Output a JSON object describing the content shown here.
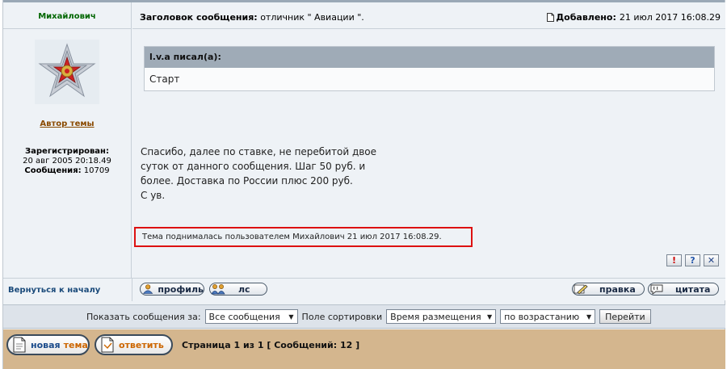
{
  "author": {
    "name": "Михайлович",
    "role": "Автор темы",
    "registered_label": "Зарегистрирован:",
    "registered_date": "20 авг 2005 20:18.49",
    "posts_label": "Сообщения:",
    "posts_count": "10709",
    "avatar_icon": "medal-icon"
  },
  "message": {
    "subject_label": "Заголовок сообщения:",
    "subject": "отличник \" Авиации \".",
    "added_label": "Добавлено:",
    "added_date": "21 июл 2017 16:08.29",
    "quote_author": "l.v.a писал(а):",
    "quote_text": "Старт",
    "body_lines": [
      "Спасибо, далее по ставке, не перебитой двое",
      "суток от данного сообщения. Шаг 50 руб. и",
      "более. Доставка по России плюс 200 руб.",
      "С ув."
    ],
    "bump_text": "Тема поднималась пользователем Михайлович 21 июл 2017 16:08.29.",
    "icons": [
      "report-icon",
      "help-icon",
      "close-icon"
    ]
  },
  "actions": {
    "back_to_top": "Вернуться к началу",
    "profile": "профиль",
    "pm": "лс",
    "edit": "правка",
    "quote": "цитата"
  },
  "sort": {
    "show_label": "Показать сообщения за:",
    "show_value": "Все сообщения",
    "sort_label": "Поле сортировки",
    "sort_value": "Время размещения",
    "order_value": "по возрастанию",
    "go": "Перейти"
  },
  "bottom": {
    "new_topic_a": "новая",
    "new_topic_b": "тема",
    "reply": "ответить",
    "pages": "Страница 1 из 1 [ Сообщений: 12 ]"
  },
  "colors": {
    "accent_red": "#dd1111",
    "author_green": "#006600",
    "bottom_bar": "#d4b68e"
  }
}
